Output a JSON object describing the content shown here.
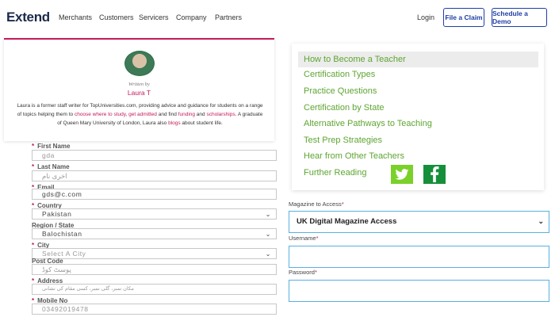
{
  "brand": {
    "logo": "Extend"
  },
  "nav": {
    "links": [
      "Merchants",
      "Customers",
      "Servicers",
      "Company",
      "Partners"
    ],
    "login": "Login",
    "file_claim": "File a Claim",
    "schedule_demo": "Schedule a Demo"
  },
  "author": {
    "written_by": "Written by",
    "name": "Laura T",
    "bio": {
      "p1": "Laura is a former staff writer for TopUniversities.com, providing advice and guidance for students on a range of topics helping them to ",
      "l1": "choose where to study",
      "p2": ", ",
      "l2": "get admitted",
      "p3": " and find ",
      "l3": "funding",
      "p4": " and ",
      "l4": "scholarships",
      "p5": ". A graduate of Queen Mary University of London, Laura also ",
      "l5": "blogs",
      "p6": " about student life."
    }
  },
  "form": {
    "first_name": {
      "label": "First Name",
      "value": "gda"
    },
    "last_name": {
      "label": "Last Name",
      "value": "اخری نام"
    },
    "email": {
      "label": "Email",
      "value": "gds@c.com"
    },
    "country": {
      "label": "Country",
      "value": "Pakistan"
    },
    "region": {
      "label": "Region / State",
      "value": "Balochistan"
    },
    "city": {
      "label": "City",
      "value": "Select A City"
    },
    "post_code": {
      "label": "Post Code",
      "value": "پوسٹ کوڈ"
    },
    "address": {
      "label": "Address",
      "value": "مکان نمبر، گلی نمبر، کسی مقام کی نشانی"
    },
    "mobile": {
      "label": "Mobile No",
      "value": "03492019478"
    }
  },
  "menu": {
    "items": [
      "How to Become a Teacher",
      "Certification Types",
      "Practice Questions",
      "Certification by State",
      "Alternative Pathways to Teaching",
      "Test Prep Strategies",
      "Hear from Other Teachers",
      "Further Reading"
    ],
    "active_index": 0
  },
  "magazine": {
    "label": "Magazine to Access",
    "selected": "UK Digital Magazine Access",
    "username_label": "Username",
    "password_label": "Password"
  },
  "colors": {
    "accent_pink": "#c41a5a",
    "menu_green": "#5ea531",
    "twitter_bg": "#7ad12a",
    "facebook_bg": "#168f3a",
    "nav_blue": "#1f3fa6"
  },
  "icons": {
    "twitter": "twitter-icon",
    "facebook": "facebook-icon"
  }
}
